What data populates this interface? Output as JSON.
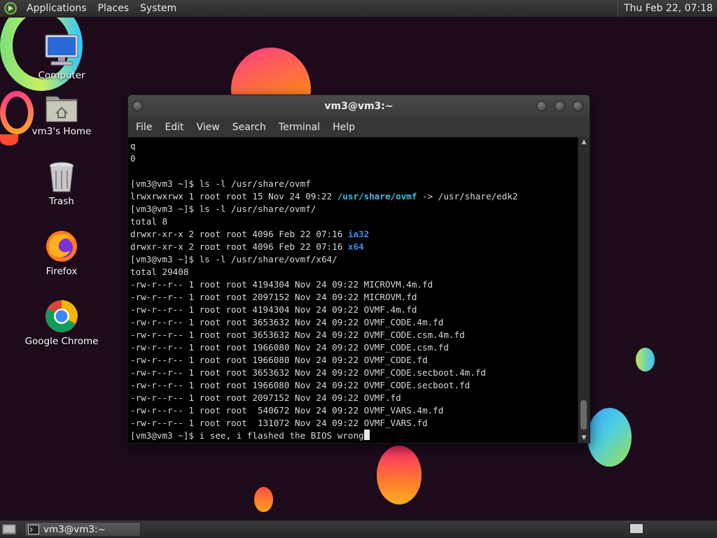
{
  "top_panel": {
    "menus": [
      "Applications",
      "Places",
      "System"
    ],
    "clock": "Thu Feb 22, 07:18"
  },
  "desktop_icons": [
    {
      "label": "Computer",
      "icon": "computer-icon"
    },
    {
      "label": "vm3's Home",
      "icon": "home-folder-icon"
    },
    {
      "label": "Trash",
      "icon": "trash-icon"
    },
    {
      "label": "Firefox",
      "icon": "firefox-icon"
    },
    {
      "label": "Google Chrome",
      "icon": "chrome-icon"
    }
  ],
  "terminal": {
    "title": "vm3@vm3:~",
    "menu": [
      "File",
      "Edit",
      "View",
      "Search",
      "Terminal",
      "Help"
    ],
    "lines": [
      "q",
      "0",
      "",
      "[vm3@vm3 ~]$ ls -l /usr/share/ovmf",
      {
        "pre": "lrwxrwxrwx 1 root root 15 Nov 24 09:22 ",
        "link": "/usr/share/ovmf",
        "post": " -> /usr/share/edk2"
      },
      "[vm3@vm3 ~]$ ls -l /usr/share/ovmf/",
      "total 8",
      {
        "pre": "drwxr-xr-x 2 root root 4096 Feb 22 07:16 ",
        "dir": "ia32"
      },
      {
        "pre": "drwxr-xr-x 2 root root 4096 Feb 22 07:16 ",
        "dir": "x64"
      },
      "[vm3@vm3 ~]$ ls -l /usr/share/ovmf/x64/",
      "total 29408",
      "-rw-r--r-- 1 root root 4194304 Nov 24 09:22 MICROVM.4m.fd",
      "-rw-r--r-- 1 root root 2097152 Nov 24 09:22 MICROVM.fd",
      "-rw-r--r-- 1 root root 4194304 Nov 24 09:22 OVMF.4m.fd",
      "-rw-r--r-- 1 root root 3653632 Nov 24 09:22 OVMF_CODE.4m.fd",
      "-rw-r--r-- 1 root root 3653632 Nov 24 09:22 OVMF_CODE.csm.4m.fd",
      "-rw-r--r-- 1 root root 1966080 Nov 24 09:22 OVMF_CODE.csm.fd",
      "-rw-r--r-- 1 root root 1966080 Nov 24 09:22 OVMF_CODE.fd",
      "-rw-r--r-- 1 root root 3653632 Nov 24 09:22 OVMF_CODE.secboot.4m.fd",
      "-rw-r--r-- 1 root root 1966080 Nov 24 09:22 OVMF_CODE.secboot.fd",
      "-rw-r--r-- 1 root root 2097152 Nov 24 09:22 OVMF.fd",
      "-rw-r--r-- 1 root root  540672 Nov 24 09:22 OVMF_VARS.4m.fd",
      "-rw-r--r-- 1 root root  131072 Nov 24 09:22 OVMF_VARS.fd",
      {
        "pre": "[vm3@vm3 ~]$ i see, i flashed the BIOS wrong",
        "cursor": true
      }
    ]
  },
  "taskbar": {
    "task_label": "vm3@vm3:~"
  },
  "colors": {
    "link": "#3fbce8",
    "directory": "#3f8be8",
    "terminal_bg": "#000000",
    "wallpaper": "#1d0b1c"
  }
}
